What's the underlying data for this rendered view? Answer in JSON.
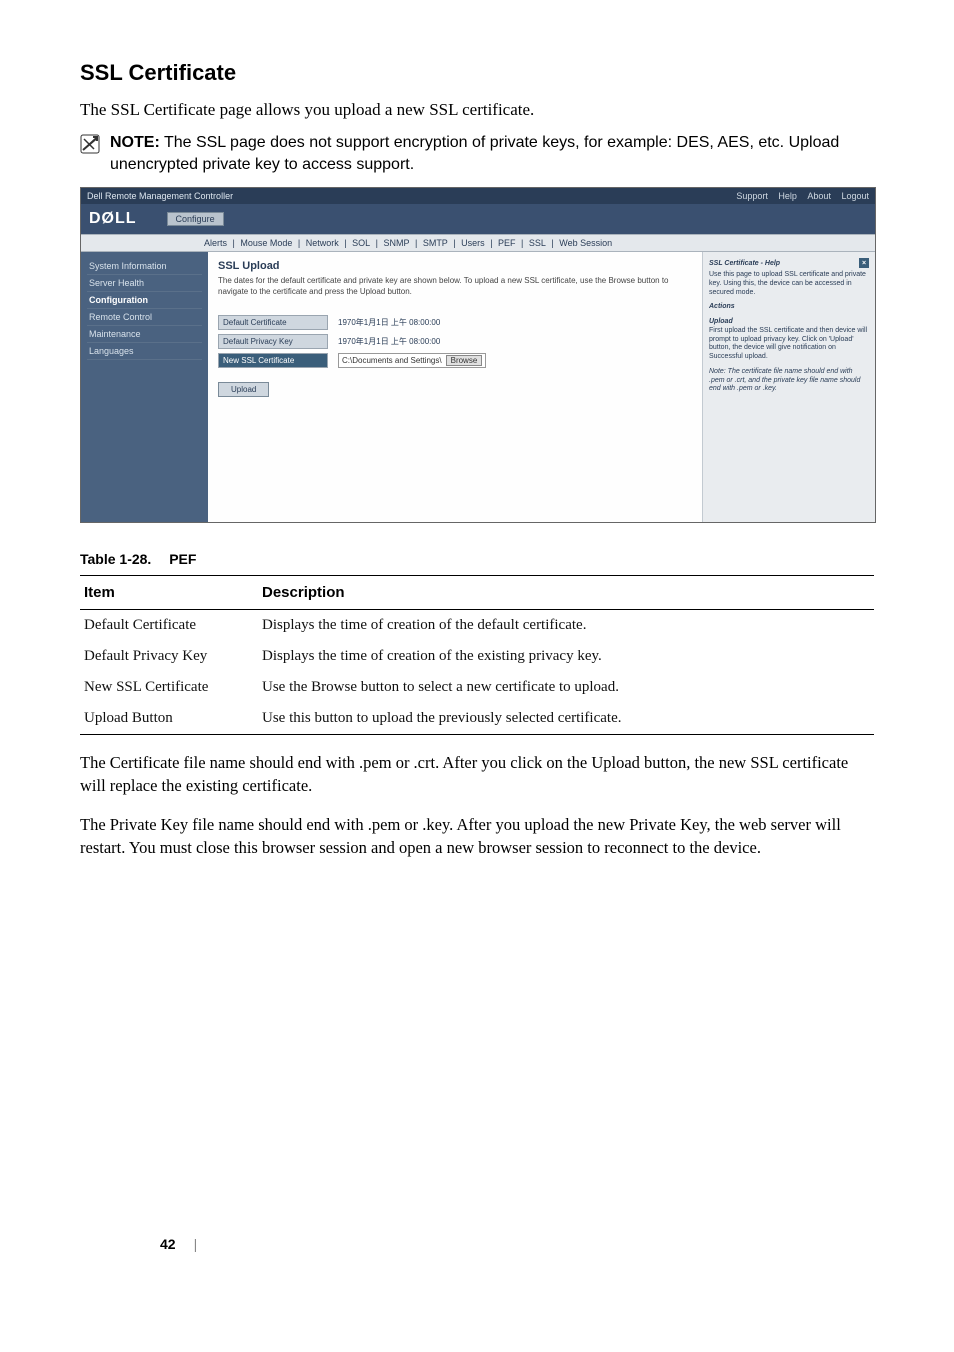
{
  "heading": "SSL Certificate",
  "intro": "The SSL Certificate page allows you upload a new SSL certificate.",
  "note": {
    "label": "NOTE:",
    "text": " The SSL page does not support encryption of private keys, for example: DES, AES, etc. Upload unencrypted private key to access support."
  },
  "screenshot": {
    "window_title": "Dell Remote Management Controller",
    "top_links": [
      "Support",
      "Help",
      "About",
      "Logout"
    ],
    "brand": "DØLL",
    "configure": "Configure",
    "tabs": [
      "Alerts",
      "Mouse Mode",
      "Network",
      "SOL",
      "SNMP",
      "SMTP",
      "Users",
      "PEF",
      "SSL",
      "Web Session"
    ],
    "sidebar": {
      "items": [
        "System Information",
        "Server Health",
        "Configuration",
        "Remote Control",
        "Maintenance",
        "Languages"
      ],
      "active_index": 2
    },
    "main": {
      "title": "SSL Upload",
      "desc": "The dates for the default certificate and private key are shown below. To upload a new SSL certificate, use the Browse button to navigate to the certificate and press the Upload button.",
      "rows": {
        "default_cert": {
          "label": "Default Certificate",
          "value": "1970年1月1日 上午 08:00:00"
        },
        "default_key": {
          "label": "Default Privacy Key",
          "value": "1970年1月1日 上午 08:00:00"
        },
        "new_cert": {
          "label": "New SSL Certificate",
          "path": "C:\\Documents and Settings\\",
          "browse": "Browse"
        }
      },
      "upload": "Upload"
    },
    "help": {
      "title": "SSL Certificate - Help",
      "intro": "Use this page to upload SSL certificate and private key. Using this, the device can be accessed in secured mode.",
      "actions_heading": "Actions",
      "upload_heading": "Upload",
      "upload_text": "First upload the SSL certificate and then device will prompt to upload privacy key. Click on 'Upload' button, the device will give notification on Successful upload.",
      "note": "Note: The certificate file name should end with .pem or .crt, and the private key file name should end with .pem or .key."
    }
  },
  "table": {
    "caption_num": "Table 1-28.",
    "caption_title": "PEF",
    "headers": {
      "item": "Item",
      "desc": "Description"
    },
    "rows": [
      {
        "item": "Default Certificate",
        "desc": "Displays the time of creation of the default certificate."
      },
      {
        "item": "Default Privacy Key",
        "desc": "Displays the time of creation of the existing privacy key."
      },
      {
        "item": "New SSL Certificate",
        "desc": "Use the Browse button to select a new certificate to upload."
      },
      {
        "item": "Upload Button",
        "desc": "Use this button to upload the previously selected certificate."
      }
    ]
  },
  "para1": "The Certificate file name should end with .pem or .crt. After you click on the Upload button, the new SSL certificate will replace the existing certificate.",
  "para2": "The Private Key file name should end with .pem or .key. After you upload the new Private Key, the web server will restart. You must close this browser session and open a new browser session to reconnect to the device.",
  "page_number": "42"
}
